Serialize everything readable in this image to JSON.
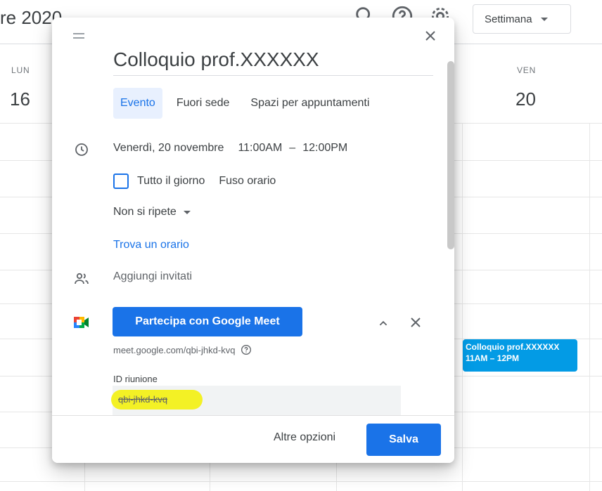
{
  "calendar": {
    "month_title": "re 2020",
    "view_selector": "Settimana",
    "days": [
      {
        "label": "LUN",
        "number": "16"
      },
      {
        "label": "VEN",
        "number": "20"
      }
    ],
    "event_chip": {
      "title": "Colloquio prof.XXXXXX",
      "time": "11AM – 12PM",
      "color": "#039be5"
    }
  },
  "dialog": {
    "title": "Colloquio prof.XXXXXX",
    "tabs": [
      {
        "label": "Evento",
        "active": true
      },
      {
        "label": "Fuori sede",
        "active": false
      },
      {
        "label": "Spazi per appuntamenti",
        "active": false
      }
    ],
    "date": "Venerdì, 20 novembre",
    "start_time": "11:00AM",
    "separator": "–",
    "end_time": "12:00PM",
    "all_day_label": "Tutto il giorno",
    "timezone_label": "Fuso orario",
    "repeat_label": "Non si ripete",
    "find_time_label": "Trova un orario",
    "guests_placeholder": "Aggiungi invitati",
    "meet": {
      "join_button": "Partecipa con Google Meet",
      "link": "meet.google.com/qbi-jhkd-kvq",
      "id_label": "ID riunione",
      "id_value": "qbi-jhkd-kvq"
    },
    "footer": {
      "more_options": "Altre opzioni",
      "save": "Salva"
    }
  },
  "colors": {
    "accent": "#1a73e8",
    "accent_light": "#e8f0fe",
    "highlight": "#f3f000"
  },
  "icons": [
    "drag-handle-icon",
    "close-icon",
    "clock-icon",
    "people-icon",
    "google-meet-icon",
    "chevron-up-icon",
    "help-icon",
    "search-icon",
    "help-circle-icon",
    "gear-icon"
  ]
}
